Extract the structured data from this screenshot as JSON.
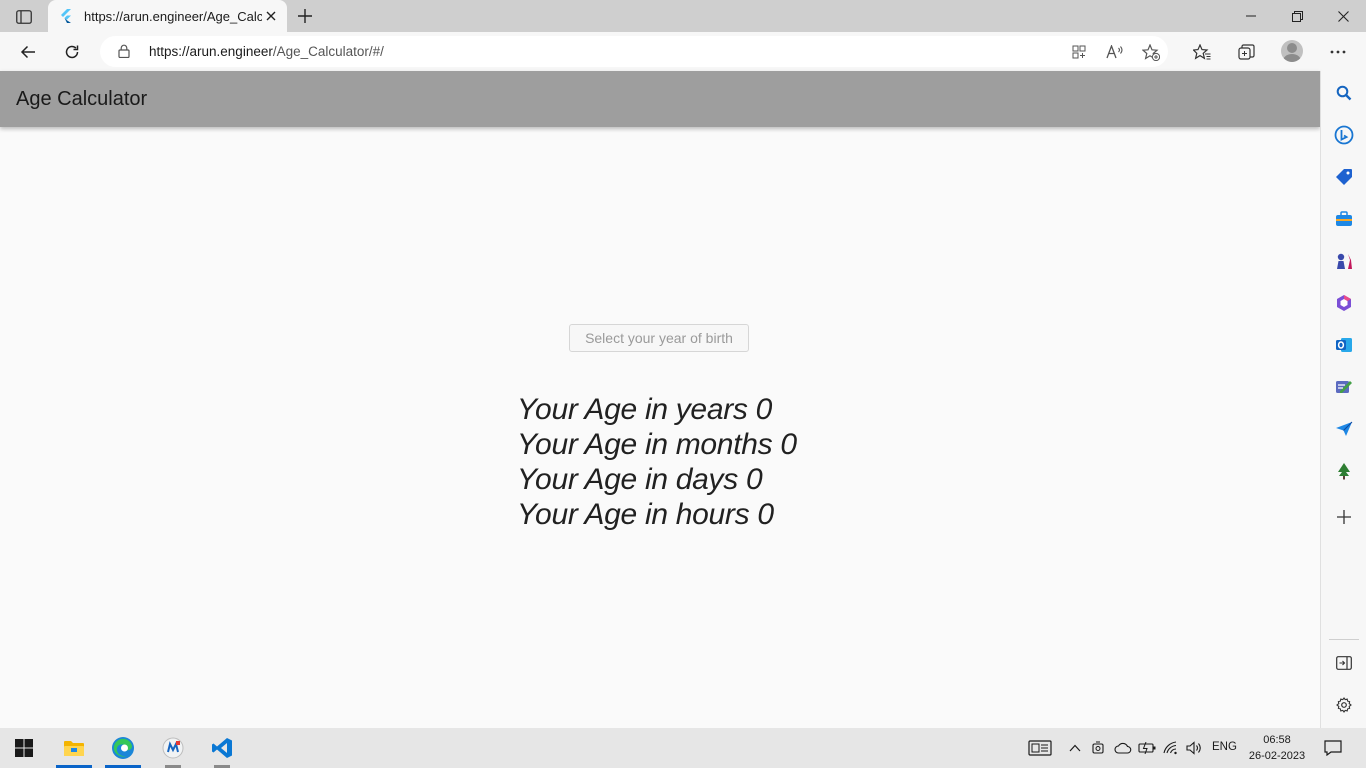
{
  "browser": {
    "tab_title": "https://arun.engineer/Age_Calculator/#/",
    "url_origin": "https://arun.engineer",
    "url_path": "/Age_Calculator/#/"
  },
  "app": {
    "title": "Age Calculator",
    "dob_button_label": "Select your year of birth",
    "results": [
      "Your Age in years 0",
      "Your Age in months 0",
      "Your Age in days 0",
      "Your Age in hours 0"
    ]
  },
  "taskbar": {
    "language": "ENG",
    "time": "06:58",
    "date": "26-02-2023"
  },
  "colors": {
    "appbar": "#9e9e9e",
    "page_bg": "#fafafa",
    "accent": "#0a64c8"
  }
}
